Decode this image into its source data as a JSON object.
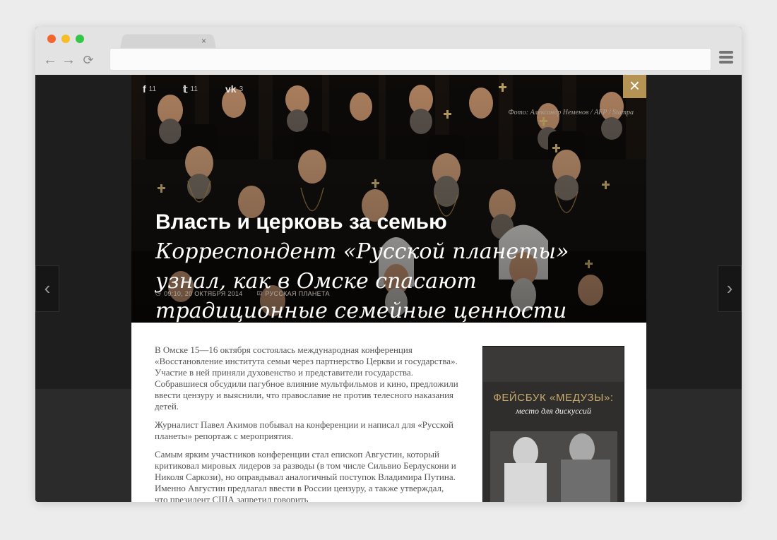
{
  "browser": {
    "tab_close": "×",
    "back_icon": "←",
    "forward_icon": "→",
    "reload_icon": "⟳"
  },
  "share": {
    "facebook": {
      "icon": "f",
      "count": "11"
    },
    "twitter": {
      "icon": "𝕥",
      "count": "11"
    },
    "vk": {
      "icon": "vk",
      "count": "3"
    }
  },
  "hero": {
    "photo_credit": "Фото: Александр Неменов / AFP / Stampa",
    "title_bold": "Власть и церковь за семью",
    "title_italic": "Корреспондент «Русской планеты» узнал, как в Омске спасают традиционные семейные ценности",
    "time": "09:10, 20 ОКТЯБРЯ 2014",
    "source": "РУССКАЯ ПЛАНЕТА",
    "close_label": "×"
  },
  "paragraphs": [
    "В Омске 15—16 октября состоялась международная конференция «Восстановление института семьи через партнерство Церкви и государства». Участие в ней приняли духовенство и представители государства. Собравшиеся обсудили пагубное влияние мультфильмов и кино, предложили ввести цензуру и выяснили, что православие не против телесного наказания детей.",
    "Журналист Павел Акимов побывал на конференции и написал для «Русской планеты» репортаж с мероприятия.",
    "Самым ярким участников конференции стал епископ Августин, который критиковал мировых лидеров за разводы (в том числе Сильвио Берлускони и Николя Саркози), но оправдывал аналогичный поступок Владимира Путина. Именно Августин предлагал ввести в России цензуру, а также утверждал, что президент США запретил говорить"
  ],
  "ad": {
    "title": "ФЕЙСБУК «МЕДУЗЫ»:",
    "subtitle": "место для дискуссий"
  },
  "nav": {
    "prev": "‹",
    "next": "›"
  },
  "colors": {
    "accent": "#b49354",
    "page_bg": "#ececec",
    "overlay": "#1e1e1e"
  }
}
